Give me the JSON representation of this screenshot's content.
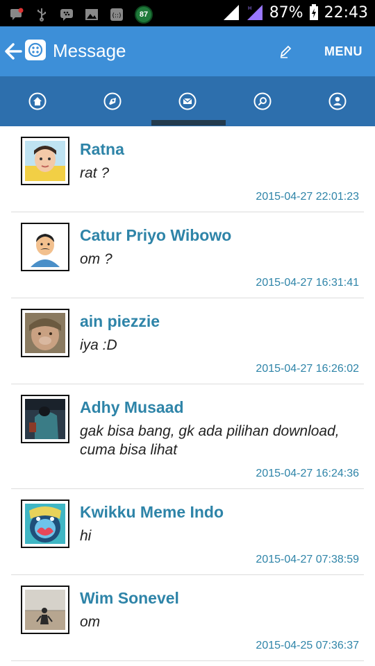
{
  "status_bar": {
    "battery": "87%",
    "time": "22:43",
    "badge": "87",
    "icons": [
      "chat-notification-icon",
      "usb-icon",
      "bbm-icon",
      "image-icon",
      "app-icon",
      "badge-87-icon",
      "signal-icon",
      "signal-roaming-icon",
      "battery-charging-icon"
    ]
  },
  "app_bar": {
    "title": "Message",
    "menu_label": "MENU",
    "icons": [
      "back-arrow-icon",
      "app-logo-icon",
      "pencil-edit-icon"
    ]
  },
  "tabs": [
    {
      "name": "home",
      "icon": "home-icon"
    },
    {
      "name": "explore",
      "icon": "rocket-icon"
    },
    {
      "name": "messages",
      "icon": "envelope-icon",
      "active": true
    },
    {
      "name": "search",
      "icon": "search-icon"
    },
    {
      "name": "profile",
      "icon": "user-icon"
    }
  ],
  "messages": [
    {
      "name": "Ratna",
      "text": "rat ?",
      "time": "2015-04-27 22:01:23"
    },
    {
      "name": "Catur Priyo Wibowo",
      "text": "om ?",
      "time": "2015-04-27 16:31:41"
    },
    {
      "name": "ain piezzie",
      "text": "iya :D",
      "time": "2015-04-27 16:26:02"
    },
    {
      "name": "Adhy Musaad",
      "text": "gak bisa bang, gk ada pilihan download, cuma bisa lihat",
      "time": "2015-04-27 16:24:36"
    },
    {
      "name": "Kwikku Meme Indo",
      "text": "hi",
      "time": "2015-04-27 07:38:59"
    },
    {
      "name": "Wim Sonevel",
      "text": "om",
      "time": "2015-04-25 07:36:37"
    }
  ],
  "colors": {
    "app_bar": "#3d8fd8",
    "tab_bar": "#2d6fad",
    "indicator": "#233b4e",
    "accent_text": "#2e84a8"
  }
}
